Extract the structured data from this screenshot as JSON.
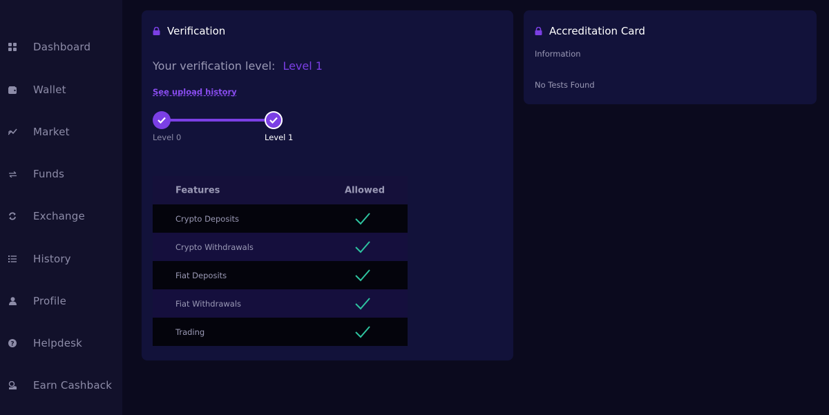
{
  "sidebar": {
    "items": [
      {
        "label": "Dashboard",
        "icon": "grid-icon"
      },
      {
        "label": "Wallet",
        "icon": "wallet-icon"
      },
      {
        "label": "Market",
        "icon": "chart-line-icon"
      },
      {
        "label": "Funds",
        "icon": "arrows-icon"
      },
      {
        "label": "Exchange",
        "icon": "sync-icon"
      },
      {
        "label": "History",
        "icon": "list-icon"
      },
      {
        "label": "Profile",
        "icon": "user-icon"
      },
      {
        "label": "Helpdesk",
        "icon": "question-icon"
      },
      {
        "label": "Earn Cashback",
        "icon": "cashback-icon"
      }
    ]
  },
  "verification": {
    "title": "Verification",
    "level_label": "Your verification level:",
    "level_value": "Level 1",
    "upload_link": "See upload history",
    "steps": [
      {
        "label": "Level 0",
        "completed": true
      },
      {
        "label": "Level 1",
        "completed": true,
        "current": true
      }
    ],
    "table": {
      "headers": {
        "features": "Features",
        "allowed": "Allowed"
      },
      "rows": [
        {
          "feature": "Crypto Deposits",
          "allowed": true
        },
        {
          "feature": "Crypto Withdrawals",
          "allowed": true
        },
        {
          "feature": "Fiat Deposits",
          "allowed": true
        },
        {
          "feature": "Fiat Withdrawals",
          "allowed": true
        },
        {
          "feature": "Trading",
          "allowed": true
        }
      ]
    }
  },
  "accreditation": {
    "title": "Accreditation Card",
    "info_label": "Information",
    "empty_text": "No Tests Found"
  },
  "colors": {
    "accent": "#7b3fe4",
    "check": "#2ec4a0",
    "background": "#0b0a1e",
    "sidebar": "#12112b",
    "card": "#12123a"
  }
}
